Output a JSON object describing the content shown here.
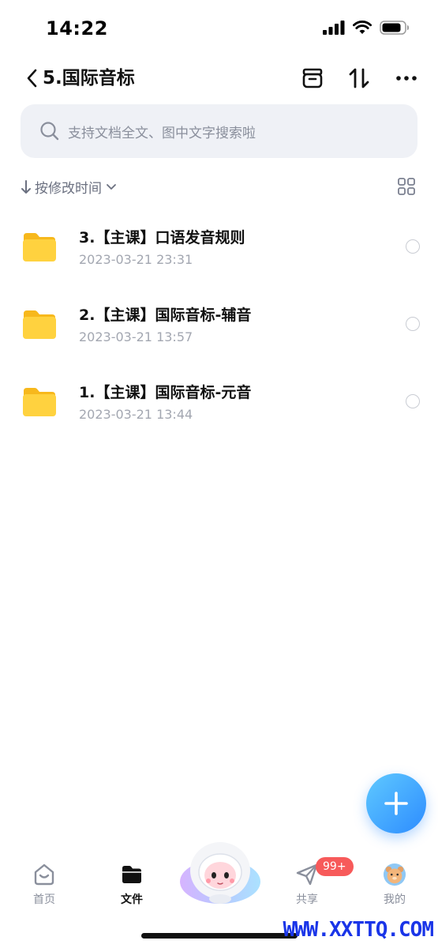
{
  "status_bar": {
    "time": "14:22"
  },
  "nav": {
    "title": "5.国际音标"
  },
  "search": {
    "placeholder": "支持文档全文、图中文字搜索啦"
  },
  "sort": {
    "label": "按修改时间"
  },
  "files": [
    {
      "name": "3.【主课】口语发音规则",
      "date": "2023-03-21 23:31"
    },
    {
      "name": "2.【主课】国际音标-辅音",
      "date": "2023-03-21 13:57"
    },
    {
      "name": "1.【主课】国际音标-元音",
      "date": "2023-03-21 13:44"
    }
  ],
  "tabs": [
    {
      "label": "首页",
      "icon": "home-icon",
      "active": false
    },
    {
      "label": "文件",
      "icon": "folder-icon",
      "active": true
    },
    {
      "label": "共享",
      "icon": "paper-plane-icon",
      "active": false
    },
    {
      "label": "我的",
      "icon": "avatar-icon",
      "active": false
    }
  ],
  "share_badge": "99+",
  "watermark": "WWW.XXTTQ.COM",
  "colors": {
    "accent": "#2d8cff",
    "folder": "#ffc93c",
    "badge": "#f75a5a",
    "search_bg": "#eff1f6"
  }
}
